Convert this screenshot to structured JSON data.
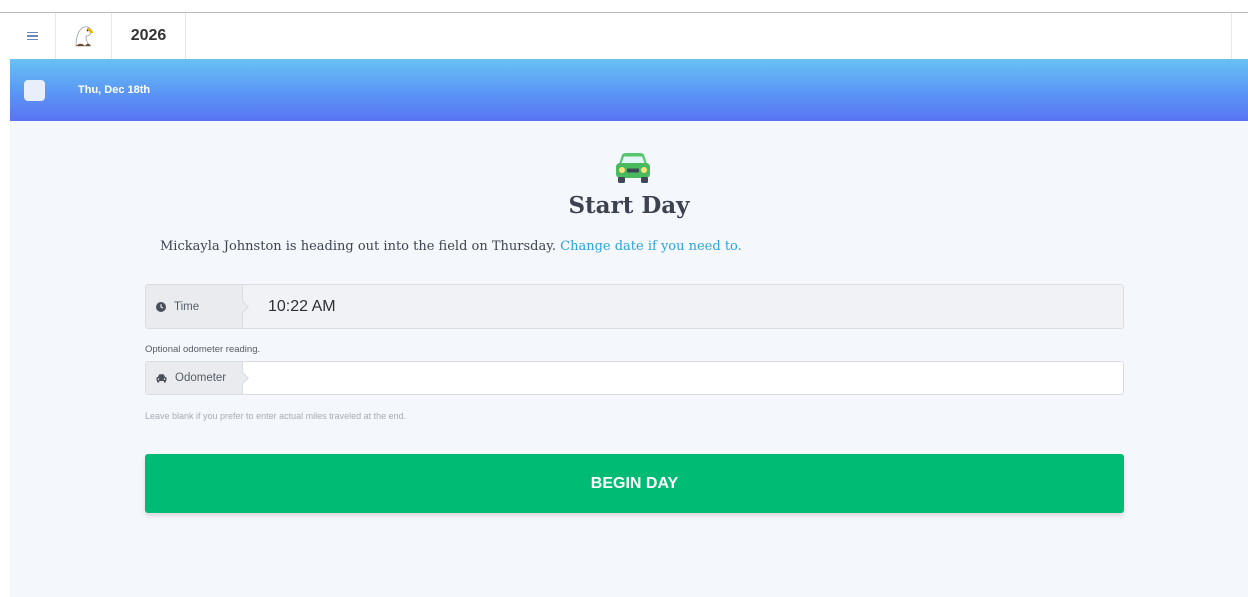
{
  "app": {
    "year": "2026"
  },
  "banner": {
    "date": "Thu, Dec 18th"
  },
  "page": {
    "title": "Start Day",
    "intro": "Mickayla Johnston is heading out into the field on Thursday.",
    "change_date_link": "Change date if you need to."
  },
  "form": {
    "time": {
      "label": "Time",
      "value": "10:22 AM"
    },
    "odometer_note": "Optional odometer reading.",
    "odometer": {
      "label": "Odometer",
      "value": "",
      "placeholder": ""
    },
    "odometer_help": "Leave blank if you prefer to enter actual miles traveled at the end."
  },
  "actions": {
    "begin_label": "BEGIN DAY"
  },
  "colors": {
    "accent_green": "#00bb73",
    "link_blue": "#2ba3e0",
    "banner_top": "#68c1f3",
    "banner_bottom": "#5a73f3"
  },
  "icons": {
    "menu": "hamburger-icon",
    "logo": "eagle-logo",
    "clock": "clock-icon",
    "car": "car-icon"
  }
}
